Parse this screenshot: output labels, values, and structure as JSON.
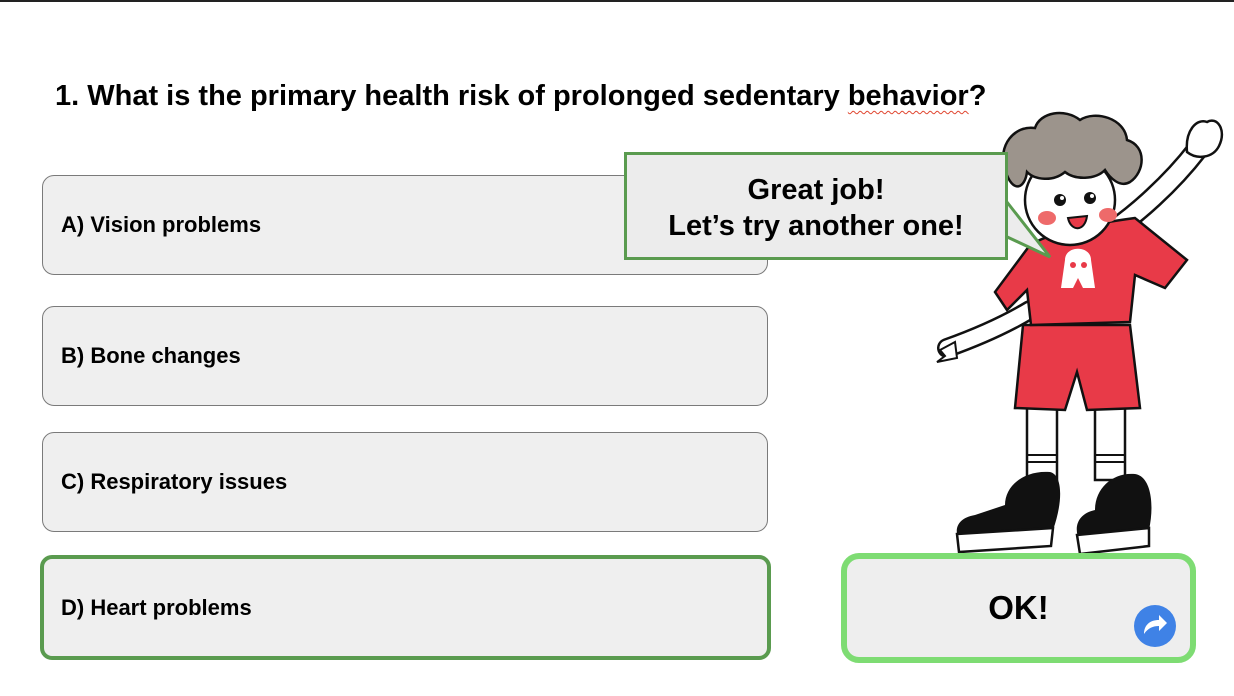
{
  "question": {
    "text_before": "1. What is the primary health risk of prolonged sedentary ",
    "text_flagged": "behavior",
    "text_after": "?"
  },
  "options": [
    {
      "label": "A) Vision problems"
    },
    {
      "label": "B) Bone changes"
    },
    {
      "label": "C) Respiratory issues"
    },
    {
      "label": "D) Heart problems",
      "selected": true
    }
  ],
  "feedback": {
    "line1": "Great job!",
    "line2": "Let’s try another one!"
  },
  "ok_button": {
    "label": "OK!",
    "icon": "redo-arrow-icon"
  },
  "colors": {
    "selected_border": "#5a9b4f",
    "ok_border": "#7edc73",
    "next_icon": "#3f82e6",
    "shirt": "#e83a48"
  }
}
